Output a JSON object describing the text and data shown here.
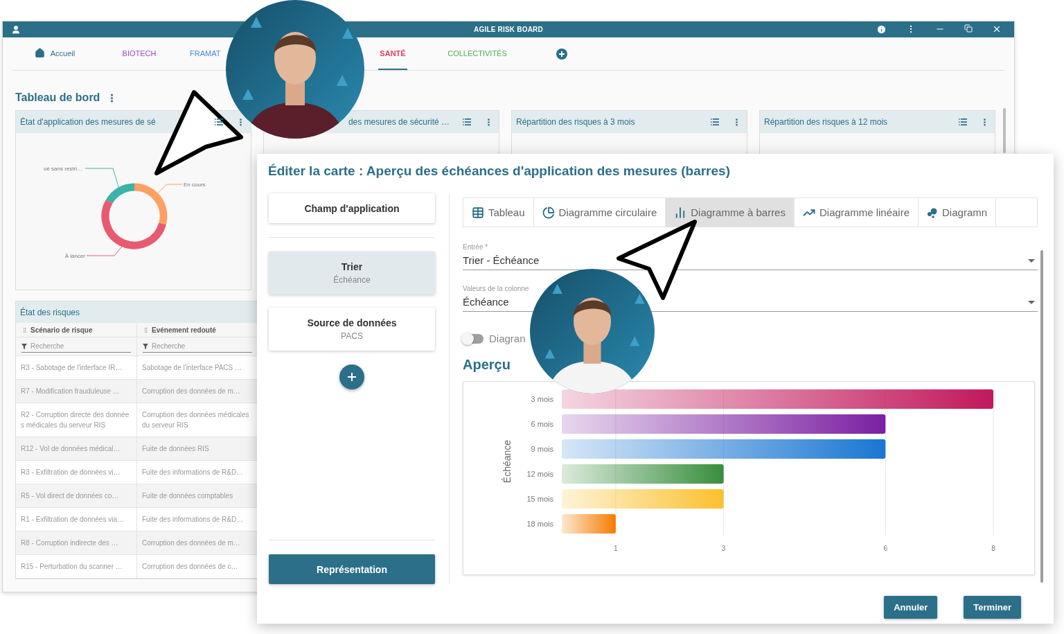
{
  "app_window": {
    "title": "AGILE RISK BOARD",
    "tabs": [
      {
        "label": "Accueil",
        "kind": "home",
        "color": "#2b6f88",
        "selected": false
      },
      {
        "label": "BIOTECH",
        "kind": "text",
        "color": "#a346c4",
        "selected": false
      },
      {
        "label": "FRAMAT",
        "kind": "text",
        "color": "#3d8bd9",
        "selected": false
      },
      {
        "label": "SANTÉ",
        "kind": "text",
        "color": "#e0405f",
        "selected": true
      },
      {
        "label": "COLLECTIVITÉS",
        "kind": "text",
        "color": "#4caf50",
        "selected": false
      }
    ],
    "dashboard_title": "Tableau de bord",
    "cards": [
      {
        "title": "État d'application des mesures de sé",
        "donut_labels": [
          {
            "label": "ué sans restri…",
            "color": "#3bb3a6"
          },
          {
            "label": "En cours",
            "color": "#ff9f63"
          },
          {
            "label": "À lancer",
            "color": "#e85a70"
          }
        ]
      },
      {
        "title": "des mesures de sécurité …"
      },
      {
        "title": "Répartition des risques à 3 mois"
      },
      {
        "title": "Répartition des risques à 12 mois"
      }
    ],
    "risk_table": {
      "title": "État des risques",
      "columns": [
        {
          "label": "Scénario de risque",
          "filter_placeholder": "Recherche"
        },
        {
          "label": "Evénement redouté",
          "filter_placeholder": "Recherche"
        }
      ],
      "rows": [
        [
          "R3 - Sabotage de l'interface IR…",
          "Sabotage de l'interface PACS …"
        ],
        [
          "R7 - Modification frauduleuse …",
          "Corruption des données de m…"
        ],
        [
          "R2 - Corruption directe des données médicales du serveur RIS",
          "Corruption des données médicales du serveur RIS"
        ],
        [
          "R12 - Vol de données médical…",
          "Fuite de données RIS"
        ],
        [
          "R3 - Exfiltration de données vi…",
          "Fuite des informations de R&D…"
        ],
        [
          "R5 - Vol direct de données co…",
          "Fuite de données comptables"
        ],
        [
          "R1 - Exfiltration de données via…",
          "Fuite des informations de R&D…"
        ],
        [
          "R8 - Corruption indirecte des …",
          "Corruption des données de m…"
        ],
        [
          "R15 - Perturbation du scanner …",
          "Corruption des données de c…"
        ]
      ]
    }
  },
  "dialog": {
    "title": "Éditer la carte : Aperçu des échéances d'application des mesures (barres)",
    "steps": [
      {
        "title": "Champ d'application",
        "selected": false
      },
      {
        "title": "Trier",
        "subtitle": "Échéance",
        "selected": true
      },
      {
        "title": "Source de données",
        "subtitle": "PACS",
        "selected": false
      }
    ],
    "representation_button": "Représentation",
    "chart_types": [
      {
        "label": "Tableau",
        "kind": "table",
        "selected": false
      },
      {
        "label": "Diagramme circulaire",
        "kind": "pie",
        "selected": false
      },
      {
        "label": "Diagramme à barres",
        "kind": "bar",
        "selected": true
      },
      {
        "label": "Diagramme linéaire",
        "kind": "line",
        "selected": false
      },
      {
        "label": "Diagramn",
        "kind": "bubble",
        "selected": false
      }
    ],
    "fields": [
      {
        "label": "Entrée *",
        "value": "Trier - Échéance"
      },
      {
        "label": "Valeurs de la colonne",
        "value": "Échéance"
      }
    ],
    "toggle": {
      "label": "Diagran",
      "on": false
    },
    "preview_title": "Aperçu",
    "chart_data": {
      "type": "bar",
      "orientation": "horizontal",
      "ylabel": "Échéance",
      "categories": [
        "3 mois",
        "6 mois",
        "9 mois",
        "12 mois",
        "15 mois",
        "18 mois"
      ],
      "series": [
        {
          "color": "#c2185b",
          "values": [
            8,
            null,
            null,
            null,
            null,
            null
          ]
        },
        {
          "color": "#7b1fa2",
          "values": [
            null,
            6,
            null,
            null,
            null,
            null
          ]
        },
        {
          "color": "#1976d2",
          "values": [
            null,
            null,
            6,
            null,
            null,
            null
          ]
        },
        {
          "color": "#388e3c",
          "values": [
            null,
            null,
            null,
            3,
            null,
            null
          ]
        },
        {
          "color": "#fbc02d",
          "values": [
            null,
            null,
            null,
            null,
            3,
            null
          ]
        },
        {
          "color": "#f57c00",
          "values": [
            null,
            null,
            null,
            null,
            null,
            1
          ]
        }
      ],
      "grid": true,
      "xlim": [
        0,
        8
      ],
      "xticks": [
        1,
        3,
        6,
        8
      ]
    },
    "buttons": [
      {
        "label": "Annuler"
      },
      {
        "label": "Terminer"
      }
    ]
  }
}
